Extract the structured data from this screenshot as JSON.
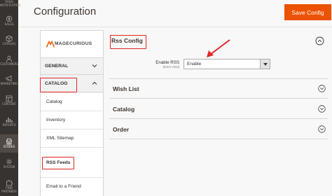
{
  "adminnav": {
    "items": [
      {
        "label": "PUSH NOTIFICATION",
        "icon": "bell-icon"
      },
      {
        "label": "SALES",
        "icon": "dollar-icon"
      },
      {
        "label": "CATALOG",
        "icon": "box-icon"
      },
      {
        "label": "CUSTOMERS",
        "icon": "person-icon"
      },
      {
        "label": "MARKETING",
        "icon": "megaphone-icon"
      },
      {
        "label": "CONTENT",
        "icon": "layout-icon"
      },
      {
        "label": "REPORTS",
        "icon": "bar-chart-icon"
      },
      {
        "label": "STORES",
        "icon": "store-icon"
      },
      {
        "label": "SYSTEM",
        "icon": "gear-icon"
      },
      {
        "label": "FIND PARTNERS",
        "icon": "puzzle-icon"
      }
    ],
    "active": "STORES"
  },
  "header": {
    "title": "Configuration",
    "save_label": "Save Config"
  },
  "sidebar": {
    "logo_text": "MAGECURIOUS",
    "sections": [
      {
        "label": "GENERAL",
        "expanded": false
      },
      {
        "label": "CATALOG",
        "expanded": true
      }
    ],
    "catalog_items": [
      "Catalog",
      "Inventory",
      "XML Sitemap",
      "RSS Feeds",
      "Email to a Friend"
    ],
    "active_item": "RSS Feeds"
  },
  "main": {
    "rss_group_title": "Rss Config",
    "enable_rss_label": "Enable RSS",
    "enable_rss_scope": "[store view]",
    "enable_rss_value": "Enable",
    "groups": [
      "Wish List",
      "Catalog",
      "Order"
    ]
  },
  "colors": {
    "accent": "#eb5202",
    "highlight": "#e22626",
    "nav_bg": "#373330"
  }
}
